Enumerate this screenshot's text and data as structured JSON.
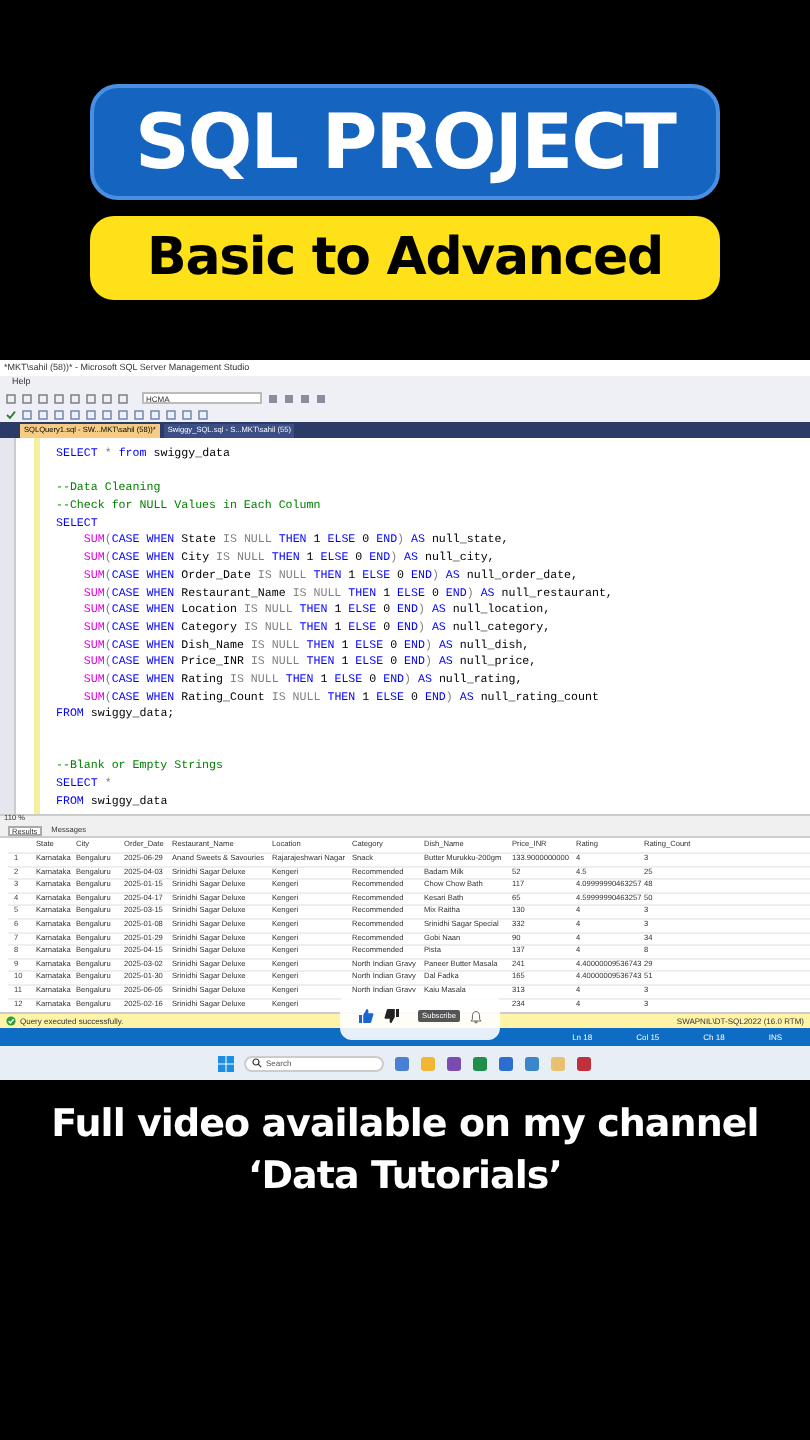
{
  "headline": {
    "title": "SQL PROJECT",
    "subtitle": "Basic to Advanced"
  },
  "window": {
    "title": "*MKT\\sahil (58))* - Microsoft SQL Server Management Studio",
    "menu": [
      "Help"
    ]
  },
  "toolbar": {
    "database": "HCMA"
  },
  "editor_tabs": [
    {
      "label": "SQLQuery1.sql - SW...MKT\\sahil (58))*",
      "selected": true
    },
    {
      "label": "Swiggy_SQL.sql - S...MKT\\sahil (55)",
      "selected": false
    }
  ],
  "code": [
    {
      "lines": [
        [
          {
            "kind": "kw",
            "text": "SELECT "
          },
          {
            "kind": "op",
            "text": "* "
          },
          {
            "kind": "kw",
            "text": "from "
          },
          {
            "kind": "plain",
            "text": "swiggy_data"
          }
        ]
      ]
    },
    {
      "lines": [
        [
          {
            "kind": "comment",
            "text": "--Data Cleaning"
          }
        ],
        [
          {
            "kind": "comment",
            "text": "--Check for NULL Values in Each Column"
          }
        ],
        [
          {
            "kind": "kw",
            "text": "SELECT"
          }
        ],
        [
          {
            "kind": "fn",
            "text": "    SUM"
          },
          {
            "kind": "op",
            "text": "("
          },
          {
            "kind": "kw",
            "text": "CASE WHEN "
          },
          {
            "kind": "plain",
            "text": "State "
          },
          {
            "kind": "op",
            "text": "IS NULL "
          },
          {
            "kind": "kw",
            "text": "THEN "
          },
          {
            "kind": "plain",
            "text": "1 "
          },
          {
            "kind": "kw",
            "text": "ELSE "
          },
          {
            "kind": "plain",
            "text": "0 "
          },
          {
            "kind": "kw",
            "text": "END"
          },
          {
            "kind": "op",
            "text": ") "
          },
          {
            "kind": "kw",
            "text": "AS "
          },
          {
            "kind": "plain",
            "text": "null_state,"
          }
        ],
        [
          {
            "kind": "fn",
            "text": "    SUM"
          },
          {
            "kind": "op",
            "text": "("
          },
          {
            "kind": "kw",
            "text": "CASE WHEN "
          },
          {
            "kind": "plain",
            "text": "City "
          },
          {
            "kind": "op",
            "text": "IS NULL "
          },
          {
            "kind": "kw",
            "text": "THEN "
          },
          {
            "kind": "plain",
            "text": "1 "
          },
          {
            "kind": "kw",
            "text": "ELSE "
          },
          {
            "kind": "plain",
            "text": "0 "
          },
          {
            "kind": "kw",
            "text": "END"
          },
          {
            "kind": "op",
            "text": ") "
          },
          {
            "kind": "kw",
            "text": "AS "
          },
          {
            "kind": "plain",
            "text": "null_city,"
          }
        ],
        [
          {
            "kind": "fn",
            "text": "    SUM"
          },
          {
            "kind": "op",
            "text": "("
          },
          {
            "kind": "kw",
            "text": "CASE WHEN "
          },
          {
            "kind": "plain",
            "text": "Order_Date "
          },
          {
            "kind": "op",
            "text": "IS NULL "
          },
          {
            "kind": "kw",
            "text": "THEN "
          },
          {
            "kind": "plain",
            "text": "1 "
          },
          {
            "kind": "kw",
            "text": "ELSE "
          },
          {
            "kind": "plain",
            "text": "0 "
          },
          {
            "kind": "kw",
            "text": "END"
          },
          {
            "kind": "op",
            "text": ") "
          },
          {
            "kind": "kw",
            "text": "AS "
          },
          {
            "kind": "plain",
            "text": "null_order_date,"
          }
        ],
        [
          {
            "kind": "fn",
            "text": "    SUM"
          },
          {
            "kind": "op",
            "text": "("
          },
          {
            "kind": "kw",
            "text": "CASE WHEN "
          },
          {
            "kind": "plain",
            "text": "Restaurant_Name "
          },
          {
            "kind": "op",
            "text": "IS NULL "
          },
          {
            "kind": "kw",
            "text": "THEN "
          },
          {
            "kind": "plain",
            "text": "1 "
          },
          {
            "kind": "kw",
            "text": "ELSE "
          },
          {
            "kind": "plain",
            "text": "0 "
          },
          {
            "kind": "kw",
            "text": "END"
          },
          {
            "kind": "op",
            "text": ") "
          },
          {
            "kind": "kw",
            "text": "AS "
          },
          {
            "kind": "plain",
            "text": "null_restaurant,"
          }
        ],
        [
          {
            "kind": "fn",
            "text": "    SUM"
          },
          {
            "kind": "op",
            "text": "("
          },
          {
            "kind": "kw",
            "text": "CASE WHEN "
          },
          {
            "kind": "plain",
            "text": "Location "
          },
          {
            "kind": "op",
            "text": "IS NULL "
          },
          {
            "kind": "kw",
            "text": "THEN "
          },
          {
            "kind": "plain",
            "text": "1 "
          },
          {
            "kind": "kw",
            "text": "ELSE "
          },
          {
            "kind": "plain",
            "text": "0 "
          },
          {
            "kind": "kw",
            "text": "END"
          },
          {
            "kind": "op",
            "text": ") "
          },
          {
            "kind": "kw",
            "text": "AS "
          },
          {
            "kind": "plain",
            "text": "null_location,"
          }
        ],
        [
          {
            "kind": "fn",
            "text": "    SUM"
          },
          {
            "kind": "op",
            "text": "("
          },
          {
            "kind": "kw",
            "text": "CASE WHEN "
          },
          {
            "kind": "plain",
            "text": "Category "
          },
          {
            "kind": "op",
            "text": "IS NULL "
          },
          {
            "kind": "kw",
            "text": "THEN "
          },
          {
            "kind": "plain",
            "text": "1 "
          },
          {
            "kind": "kw",
            "text": "ELSE "
          },
          {
            "kind": "plain",
            "text": "0 "
          },
          {
            "kind": "kw",
            "text": "END"
          },
          {
            "kind": "op",
            "text": ") "
          },
          {
            "kind": "kw",
            "text": "AS "
          },
          {
            "kind": "plain",
            "text": "null_category,"
          }
        ],
        [
          {
            "kind": "fn",
            "text": "    SUM"
          },
          {
            "kind": "op",
            "text": "("
          },
          {
            "kind": "kw",
            "text": "CASE WHEN "
          },
          {
            "kind": "plain",
            "text": "Dish_Name "
          },
          {
            "kind": "op",
            "text": "IS NULL "
          },
          {
            "kind": "kw",
            "text": "THEN "
          },
          {
            "kind": "plain",
            "text": "1 "
          },
          {
            "kind": "kw",
            "text": "ELSE "
          },
          {
            "kind": "plain",
            "text": "0 "
          },
          {
            "kind": "kw",
            "text": "END"
          },
          {
            "kind": "op",
            "text": ") "
          },
          {
            "kind": "kw",
            "text": "AS "
          },
          {
            "kind": "plain",
            "text": "null_dish,"
          }
        ],
        [
          {
            "kind": "fn",
            "text": "    SUM"
          },
          {
            "kind": "op",
            "text": "("
          },
          {
            "kind": "kw",
            "text": "CASE WHEN "
          },
          {
            "kind": "plain",
            "text": "Price_INR "
          },
          {
            "kind": "op",
            "text": "IS NULL "
          },
          {
            "kind": "kw",
            "text": "THEN "
          },
          {
            "kind": "plain",
            "text": "1 "
          },
          {
            "kind": "kw",
            "text": "ELSE "
          },
          {
            "kind": "plain",
            "text": "0 "
          },
          {
            "kind": "kw",
            "text": "END"
          },
          {
            "kind": "op",
            "text": ") "
          },
          {
            "kind": "kw",
            "text": "AS "
          },
          {
            "kind": "plain",
            "text": "null_price,"
          }
        ],
        [
          {
            "kind": "fn",
            "text": "    SUM"
          },
          {
            "kind": "op",
            "text": "("
          },
          {
            "kind": "kw",
            "text": "CASE WHEN "
          },
          {
            "kind": "plain",
            "text": "Rating "
          },
          {
            "kind": "op",
            "text": "IS NULL "
          },
          {
            "kind": "kw",
            "text": "THEN "
          },
          {
            "kind": "plain",
            "text": "1 "
          },
          {
            "kind": "kw",
            "text": "ELSE "
          },
          {
            "kind": "plain",
            "text": "0 "
          },
          {
            "kind": "kw",
            "text": "END"
          },
          {
            "kind": "op",
            "text": ") "
          },
          {
            "kind": "kw",
            "text": "AS "
          },
          {
            "kind": "plain",
            "text": "null_rating,"
          }
        ],
        [
          {
            "kind": "fn",
            "text": "    SUM"
          },
          {
            "kind": "op",
            "text": "("
          },
          {
            "kind": "kw",
            "text": "CASE WHEN "
          },
          {
            "kind": "plain",
            "text": "Rating_Count "
          },
          {
            "kind": "op",
            "text": "IS NULL "
          },
          {
            "kind": "kw",
            "text": "THEN "
          },
          {
            "kind": "plain",
            "text": "1 "
          },
          {
            "kind": "kw",
            "text": "ELSE "
          },
          {
            "kind": "plain",
            "text": "0 "
          },
          {
            "kind": "kw",
            "text": "END"
          },
          {
            "kind": "op",
            "text": ") "
          },
          {
            "kind": "kw",
            "text": "AS "
          },
          {
            "kind": "plain",
            "text": "null_rating_count"
          }
        ],
        [
          {
            "kind": "kw",
            "text": "FROM "
          },
          {
            "kind": "plain",
            "text": "swiggy_data;"
          }
        ]
      ]
    },
    {
      "lines": [
        [
          {
            "kind": "comment",
            "text": "--Blank or Empty Strings"
          }
        ],
        [
          {
            "kind": "kw",
            "text": "SELECT "
          },
          {
            "kind": "op",
            "text": "*"
          }
        ],
        [
          {
            "kind": "kw",
            "text": "FROM "
          },
          {
            "kind": "plain",
            "text": "swiggy_data"
          }
        ]
      ]
    }
  ],
  "zoom": "110 %",
  "result_tabs": [
    {
      "label": "Results",
      "selected": true
    },
    {
      "label": "Messages",
      "selected": false
    }
  ],
  "grid": {
    "columns": [
      "State",
      "City",
      "Order_Date",
      "Restaurant_Name",
      "Location",
      "Category",
      "Dish_Name",
      "Price_INR",
      "Rating",
      "Rating_Count"
    ],
    "rows": [
      {
        "number": "1",
        "cells": [
          "Karnataka",
          "Bengaluru",
          "2025-06-29",
          "Anand Sweets & Savouries",
          "Rajarajeshwari Nagar",
          "Snack",
          "Butter Murukku-200gm",
          "133.9000000000",
          "4",
          "3"
        ]
      },
      {
        "number": "2",
        "cells": [
          "Karnataka",
          "Bengaluru",
          "2025-04-03",
          "Srinidhi Sagar Deluxe",
          "Kengeri",
          "Recommended",
          "Badam Milk",
          "52",
          "4.5",
          "25"
        ]
      },
      {
        "number": "3",
        "cells": [
          "Karnataka",
          "Bengaluru",
          "2025-01-15",
          "Srinidhi Sagar Deluxe",
          "Kengeri",
          "Recommended",
          "Chow Chow Bath",
          "117",
          "4.09999990463257",
          "48"
        ]
      },
      {
        "number": "4",
        "cells": [
          "Karnataka",
          "Bengaluru",
          "2025-04-17",
          "Srinidhi Sagar Deluxe",
          "Kengeri",
          "Recommended",
          "Kesari Bath",
          "65",
          "4.59999990463257",
          "50"
        ]
      },
      {
        "number": "5",
        "cells": [
          "Karnataka",
          "Bengaluru",
          "2025-03-15",
          "Srinidhi Sagar Deluxe",
          "Kengeri",
          "Recommended",
          "Mix Raitha",
          "130",
          "4",
          "3"
        ]
      },
      {
        "number": "6",
        "cells": [
          "Karnataka",
          "Bengaluru",
          "2025-01-08",
          "Srinidhi Sagar Deluxe",
          "Kengeri",
          "Recommended",
          "Srinidhi Sagar Special",
          "332",
          "4",
          "3"
        ]
      },
      {
        "number": "7",
        "cells": [
          "Karnataka",
          "Bengaluru",
          "2025-01-29",
          "Srinidhi Sagar Deluxe",
          "Kengeri",
          "Recommended",
          "Gobi Naan",
          "90",
          "4",
          "34"
        ]
      },
      {
        "number": "8",
        "cells": [
          "Karnataka",
          "Bengaluru",
          "2025-04-15",
          "Srinidhi Sagar Deluxe",
          "Kengeri",
          "Recommended",
          "Pista",
          "137",
          "4",
          "8"
        ]
      },
      {
        "number": "9",
        "cells": [
          "Karnataka",
          "Bengaluru",
          "2025-03-02",
          "Srinidhi Sagar Deluxe",
          "Kengeri",
          "North Indian Gravy",
          "Paneer Butter Masala",
          "241",
          "4.40000009536743",
          "29"
        ]
      },
      {
        "number": "10",
        "cells": [
          "Karnataka",
          "Bengaluru",
          "2025-01-30",
          "Srinidhi Sagar Deluxe",
          "Kengeri",
          "North Indian Gravy",
          "Dal Fadka",
          "165",
          "4.40000009536743",
          "51"
        ]
      },
      {
        "number": "11",
        "cells": [
          "Karnataka",
          "Bengaluru",
          "2025-06-05",
          "Srinidhi Sagar Deluxe",
          "Kengeri",
          "North Indian Gravy",
          "Kaju Masala",
          "313",
          "4",
          "3"
        ]
      },
      {
        "number": "12",
        "cells": [
          "Karnataka",
          "Bengaluru",
          "2025-02-16",
          "Srinidhi Sagar Deluxe",
          "Kengeri",
          "",
          "",
          "234",
          "4",
          "3"
        ]
      }
    ]
  },
  "status": {
    "message": "Query executed successfully.",
    "server": "SWAPNIL\\DT-SQL2022 (16.0 RTM)"
  },
  "status_bar": [
    "Ln 18",
    "Col 15",
    "Ch 18",
    "INS"
  ],
  "taskbar": {
    "search_placeholder": "Search"
  },
  "overlay": {
    "subscribe": "Subscribe"
  },
  "caption": [
    "Full video available on my channel",
    "‘Data Tutorials’"
  ]
}
